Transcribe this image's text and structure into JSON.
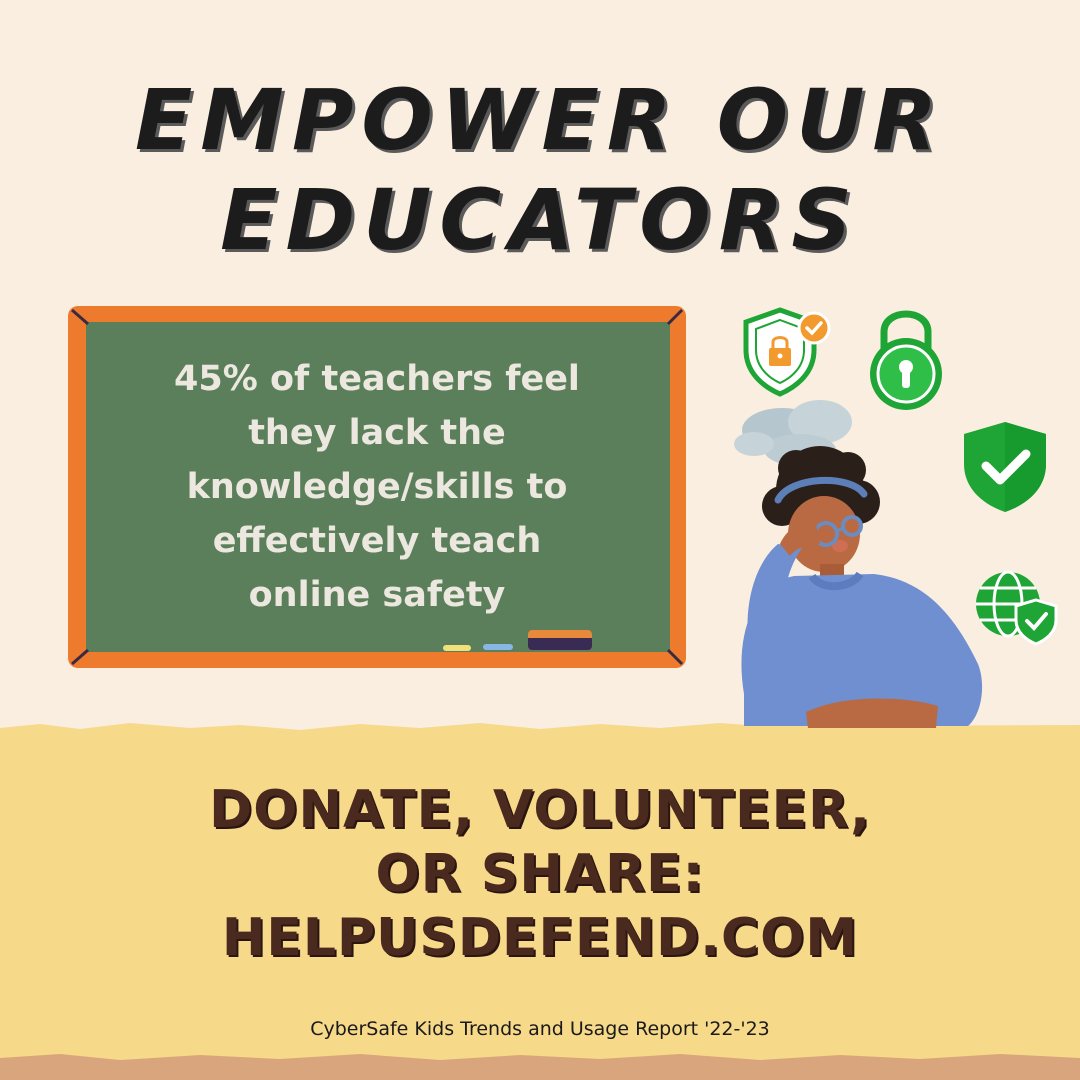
{
  "headline": {
    "line1": "EMPOWER OUR",
    "line2": "EDUCATORS"
  },
  "chalkboard": {
    "statement_lines": [
      "45% of teachers feel",
      "they lack the",
      "knowledge/skills to",
      "effectively teach",
      "online safety"
    ]
  },
  "call_to_action": {
    "line1": "DONATE, VOLUNTEER,",
    "line2": "OR SHARE:",
    "line3": "HELPUSDEFEND.COM"
  },
  "source": "CyberSafe Kids Trends and Usage Report '22-'23",
  "colors": {
    "background": "#f9eee0",
    "band": "#f7d98a",
    "board": "#5a7f5a",
    "board_frame": "#ee7a2e",
    "icon_green": "#1ea535",
    "cta_text": "#4a2a1e"
  },
  "icons": [
    "shield-lock-icon",
    "padlock-icon",
    "shield-check-icon",
    "globe-shield-icon"
  ]
}
